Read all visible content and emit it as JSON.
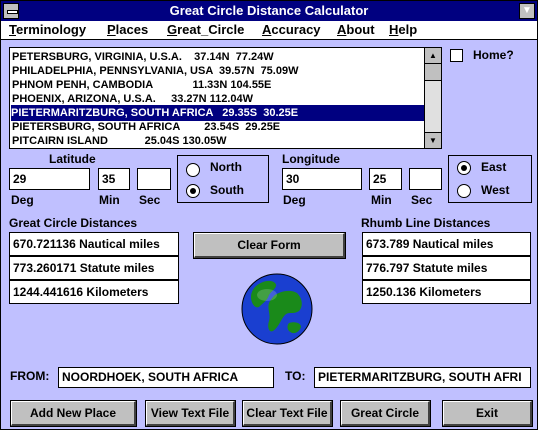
{
  "window": {
    "title": "Great Circle Distance Calculator",
    "minimize_glyph": "▼"
  },
  "menu": [
    "Terminology",
    "Places",
    "Great_Circle",
    "Accuracy",
    "About",
    "Help"
  ],
  "places_list": [
    "PETERSBURG, VIRGINIA, U.S.A.    37.14N  77.24W",
    "PHILADELPHIA, PENNSYLVANIA, USA  39.57N  75.09W",
    "PHNOM PENH, CAMBODIA             11.33N 104.55E",
    "PHOENIX, ARIZONA, U.S.A.     33.27N 112.04W",
    "PIETERMARITZBURG, SOUTH AFRICA   29.35S  30.25E",
    "PIETERSBURG, SOUTH AFRICA        23.54S  29.25E",
    "PITCAIRN ISLAND            25.04S 130.05W"
  ],
  "selected_index": 4,
  "scroll": {
    "up": "▲",
    "down": "▼"
  },
  "home_label": "Home?",
  "latitude": {
    "label": "Latitude",
    "deg": "29",
    "min": "35",
    "sec": "",
    "deg_label": "Deg",
    "min_label": "Min",
    "sec_label": "Sec",
    "north": "North",
    "south": "South",
    "selected": "South"
  },
  "longitude": {
    "label": "Longitude",
    "deg": "30",
    "min": "25",
    "sec": "",
    "deg_label": "Deg",
    "min_label": "Min",
    "sec_label": "Sec",
    "east": "East",
    "west": "West",
    "selected": "East"
  },
  "great_circle": {
    "label": "Great Circle Distances",
    "nautical": "670.721136 Nautical miles",
    "statute": "773.260171 Statute miles",
    "km": "1244.441616 Kilometers"
  },
  "rhumb_line": {
    "label": "Rhumb Line Distances",
    "nautical": "673.789 Nautical miles",
    "statute": "776.797 Statute miles",
    "km": "1250.136 Kilometers"
  },
  "clear_form": "Clear Form",
  "from": {
    "label": "FROM:",
    "value": "NOORDHOEK, SOUTH AFRICA"
  },
  "to": {
    "label": "TO:",
    "value": "PIETERMARITZBURG, SOUTH AFRI"
  },
  "buttons": [
    "Add New Place",
    "View Text File",
    "Clear Text File",
    "Great Circle",
    "Exit"
  ],
  "colors": {
    "background": "#c0c0ff",
    "titlebar": "#000080",
    "selection": "#000080",
    "globe_ocean": "#1a3fd0",
    "globe_land": "#1a8a1a"
  }
}
